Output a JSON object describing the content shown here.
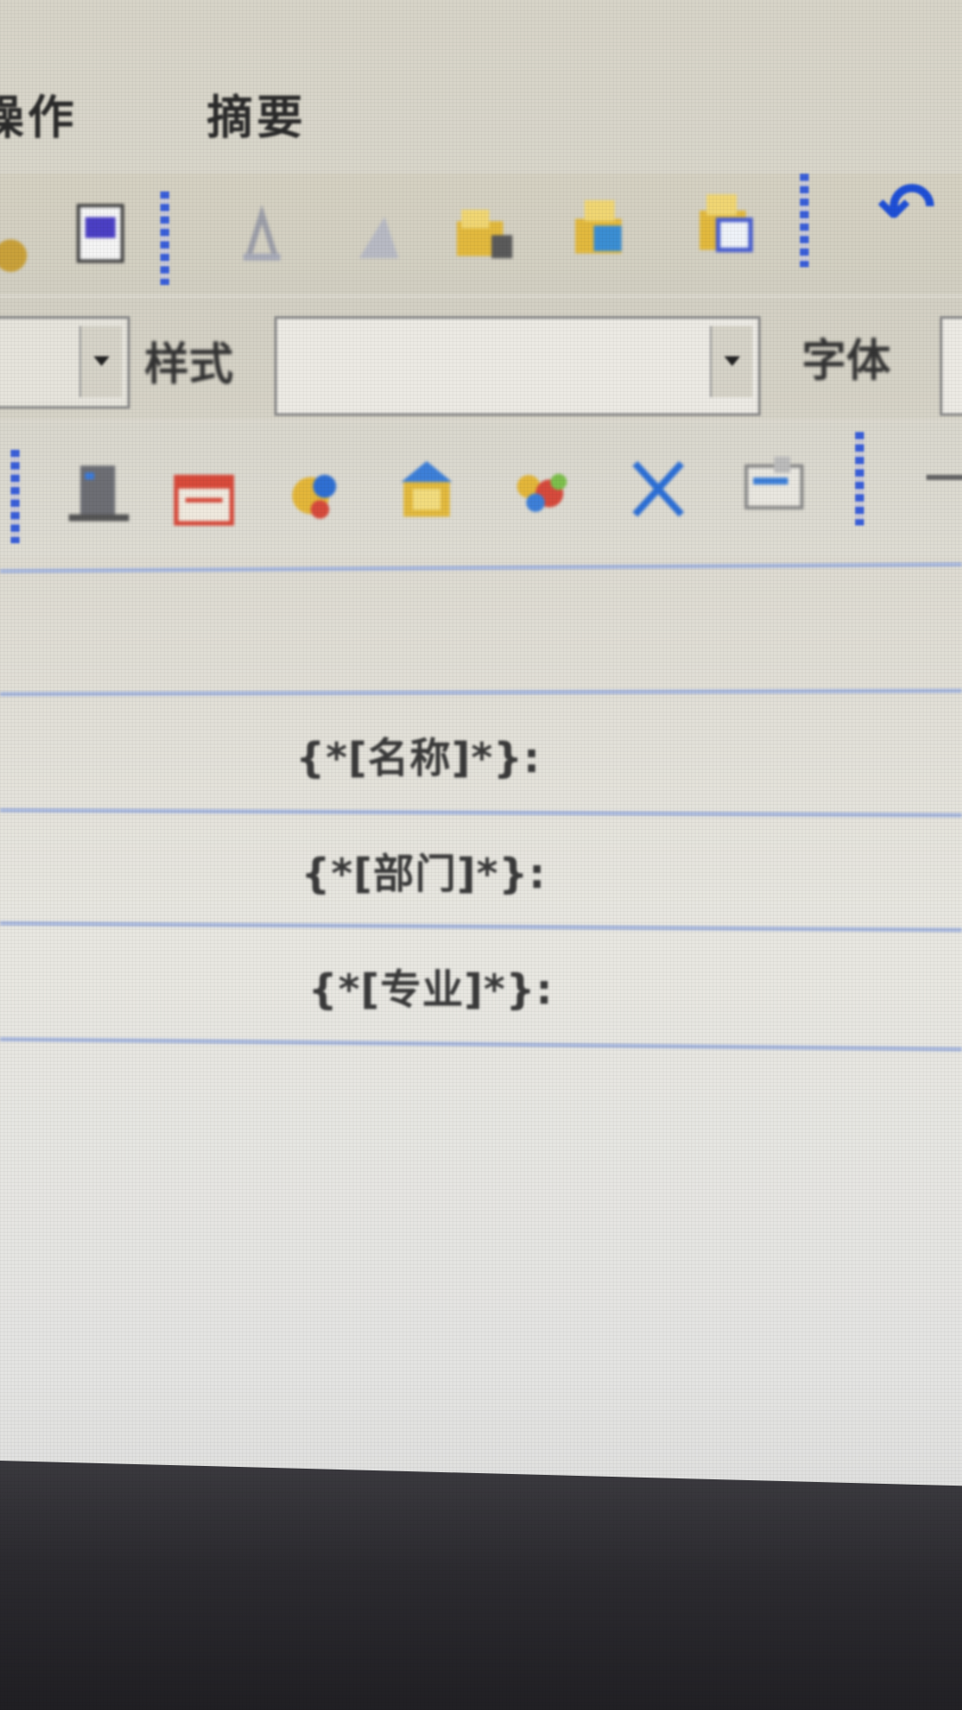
{
  "menubar": {
    "items": [
      {
        "label": "操作"
      },
      {
        "label": "摘要"
      }
    ]
  },
  "toolbar": {
    "style_label": "样式",
    "font_label": "字体",
    "style_value": "",
    "font_value": "",
    "undo_icon": "undo-icon"
  },
  "document": {
    "fields": [
      {
        "label": "{*[名称]*}:"
      },
      {
        "label": "{*[部门]*}:"
      },
      {
        "label": "{*[专业]*}:"
      }
    ]
  },
  "colors": {
    "separator": "#3a5fd9",
    "undo": "#1e4fd6",
    "table_line": "#a9b8dc"
  }
}
